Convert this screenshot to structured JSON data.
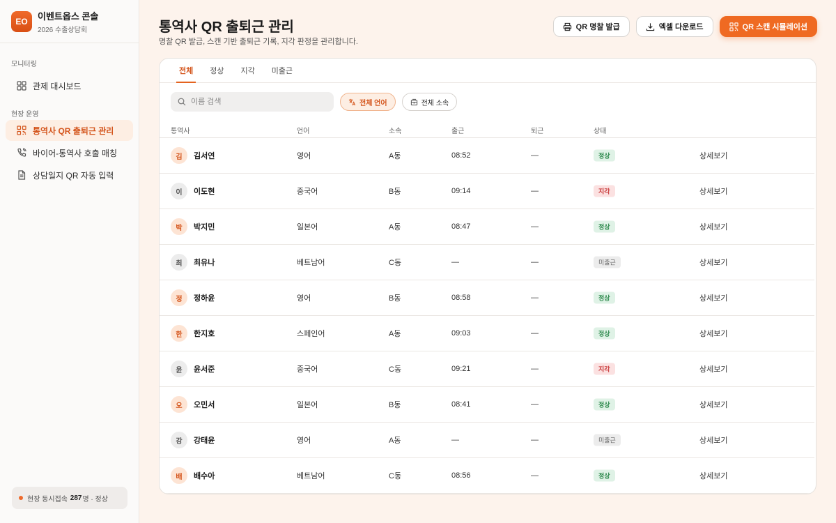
{
  "brand": {
    "logo": "EO",
    "name": "이벤트옵스 콘솔",
    "sub": "2026 수출상담회"
  },
  "sidebar": {
    "section1": "모니터링",
    "section2": "현장 운영",
    "items": [
      {
        "label": "관제 대시보드",
        "icon": "dashboard-icon"
      },
      {
        "label": "통역사 QR 출퇴근 관리",
        "icon": "qr-icon",
        "active": true
      },
      {
        "label": "바이어-통역사 호출 매칭",
        "icon": "phone-icon"
      },
      {
        "label": "상담일지 QR 자동 입력",
        "icon": "document-icon"
      }
    ],
    "status": {
      "prefix": "현장 동시접속",
      "count": "287",
      "suffix": "명 · 정상"
    }
  },
  "header": {
    "title": "통역사 QR 출퇴근 관리",
    "subtitle": "명찰 QR 발급, 스캔 기반 출퇴근 기록, 지각 판정을 관리합니다.",
    "buttons": {
      "print": "QR 명찰 발급",
      "excel": "엑셀 다운로드",
      "simulate": "QR 스캔 시뮬레이션"
    }
  },
  "tabs": [
    "전체",
    "정상",
    "지각",
    "미출근"
  ],
  "filters": {
    "search_placeholder": "이름 검색",
    "language": "전체 언어",
    "department": "전체 소속"
  },
  "table": {
    "headers": {
      "name": "통역사",
      "lang": "언어",
      "dept": "소속",
      "in": "출근",
      "out": "퇴근",
      "status": "상태"
    },
    "detail_label": "상세보기",
    "rows": [
      {
        "initial": "김",
        "name": "김서연",
        "lang": "영어",
        "dept": "A동",
        "in": "08:52",
        "out": "—",
        "status": "정상",
        "type": "ok",
        "avatar": "orange"
      },
      {
        "initial": "이",
        "name": "이도현",
        "lang": "중국어",
        "dept": "B동",
        "in": "09:14",
        "out": "—",
        "status": "지각",
        "type": "late",
        "avatar": "grey"
      },
      {
        "initial": "박",
        "name": "박지민",
        "lang": "일본어",
        "dept": "A동",
        "in": "08:47",
        "out": "—",
        "status": "정상",
        "type": "ok",
        "avatar": "orange"
      },
      {
        "initial": "최",
        "name": "최유나",
        "lang": "베트남어",
        "dept": "C동",
        "in": "—",
        "out": "—",
        "status": "미출근",
        "type": "absent",
        "avatar": "grey"
      },
      {
        "initial": "정",
        "name": "정하윤",
        "lang": "영어",
        "dept": "B동",
        "in": "08:58",
        "out": "—",
        "status": "정상",
        "type": "ok",
        "avatar": "orange"
      },
      {
        "initial": "한",
        "name": "한지호",
        "lang": "스페인어",
        "dept": "A동",
        "in": "09:03",
        "out": "—",
        "status": "정상",
        "type": "ok",
        "avatar": "orange"
      },
      {
        "initial": "윤",
        "name": "윤서준",
        "lang": "중국어",
        "dept": "C동",
        "in": "09:21",
        "out": "—",
        "status": "지각",
        "type": "late",
        "avatar": "grey"
      },
      {
        "initial": "오",
        "name": "오민서",
        "lang": "일본어",
        "dept": "B동",
        "in": "08:41",
        "out": "—",
        "status": "정상",
        "type": "ok",
        "avatar": "orange"
      },
      {
        "initial": "강",
        "name": "강태윤",
        "lang": "영어",
        "dept": "A동",
        "in": "—",
        "out": "—",
        "status": "미출근",
        "type": "absent",
        "avatar": "grey"
      },
      {
        "initial": "배",
        "name": "배수아",
        "lang": "베트남어",
        "dept": "C동",
        "in": "08:56",
        "out": "—",
        "status": "정상",
        "type": "ok",
        "avatar": "orange"
      }
    ]
  },
  "colors": {
    "accent": "#ef6a22",
    "ok": "#2f8a4e",
    "late": "#c83a3a"
  }
}
